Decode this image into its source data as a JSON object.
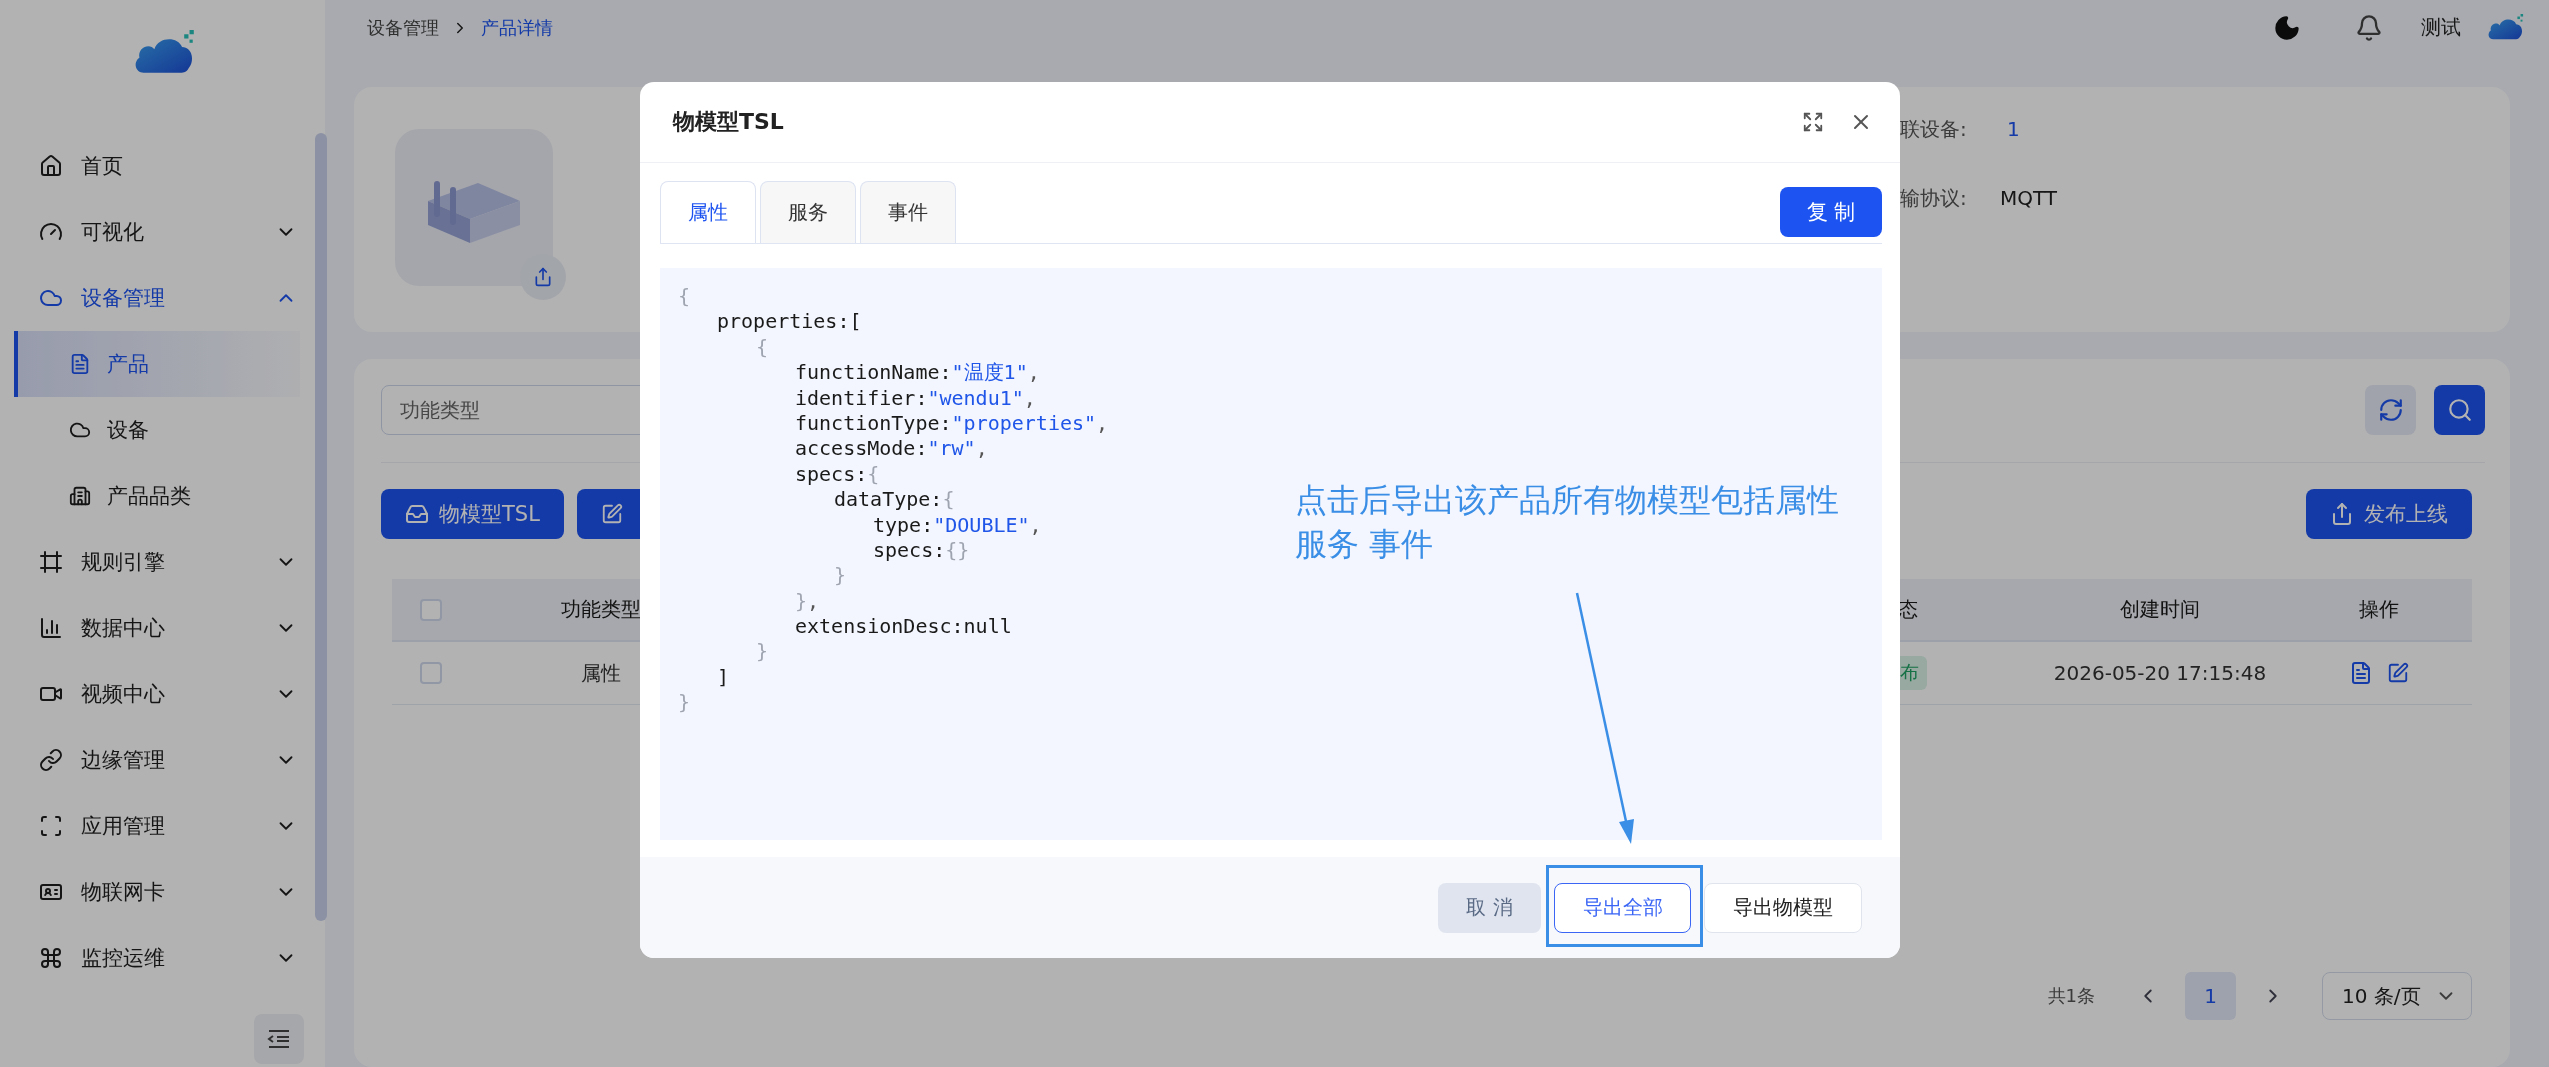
{
  "sidebar": {
    "items": [
      {
        "label": "首页",
        "kind": "link",
        "selected": false
      },
      {
        "label": "可视化",
        "kind": "group",
        "expanded": false,
        "selected": false
      },
      {
        "label": "设备管理",
        "kind": "group",
        "expanded": true,
        "selected": true,
        "children": [
          {
            "label": "产品",
            "selected": true
          },
          {
            "label": "设备",
            "selected": false
          },
          {
            "label": "产品品类",
            "selected": false
          }
        ]
      },
      {
        "label": "规则引擎",
        "kind": "group",
        "expanded": false,
        "selected": false
      },
      {
        "label": "数据中心",
        "kind": "group",
        "expanded": false,
        "selected": false
      },
      {
        "label": "视频中心",
        "kind": "group",
        "expanded": false,
        "selected": false
      },
      {
        "label": "边缘管理",
        "kind": "group",
        "expanded": false,
        "selected": false
      },
      {
        "label": "应用管理",
        "kind": "group",
        "expanded": false,
        "selected": false
      },
      {
        "label": "物联网卡",
        "kind": "group",
        "expanded": false,
        "selected": false
      },
      {
        "label": "监控运维",
        "kind": "group",
        "expanded": false,
        "selected": false
      }
    ]
  },
  "header": {
    "breadcrumb": [
      {
        "label": "设备管理",
        "current": false
      },
      {
        "label": "产品详情",
        "current": true
      }
    ],
    "user": "测试"
  },
  "product_card": {
    "fields": [
      {
        "label": "联设备:",
        "value": "1",
        "kind": "link"
      },
      {
        "label": "输协议:",
        "value": "MQTT",
        "kind": "text"
      }
    ]
  },
  "functions": {
    "filter": {
      "placeholder": "功能类型"
    },
    "buttons": [
      {
        "kind": "text",
        "label": "物模型TSL"
      },
      {
        "kind": "icon"
      }
    ],
    "publish_button": "发布上线",
    "table": {
      "all_checked": false,
      "columns": [
        "功能类型",
        "态",
        "创建时间",
        "操作"
      ],
      "rows": [
        {
          "checked": false,
          "type": "属性",
          "status": "布",
          "created": "2026-05-20 17:15:48"
        }
      ]
    },
    "pagination": {
      "total": "共1条",
      "pages": [
        {
          "label": "1",
          "selected": true
        }
      ],
      "page_size": "10 条/页"
    }
  },
  "modal": {
    "title": "物模型TSL",
    "tabs": [
      {
        "label": "属性",
        "selected": true
      },
      {
        "label": "服务",
        "selected": false
      },
      {
        "label": "事件",
        "selected": false
      }
    ],
    "copy_button": "复 制",
    "code": [
      {
        "parts": [
          {
            "kind": "brace",
            "text": "{"
          }
        ],
        "children": [
          {
            "parts": [
              {
                "kind": "key",
                "text": "properties:["
              }
            ],
            "children": [
              {
                "parts": [
                  {
                    "kind": "brace",
                    "text": "{"
                  }
                ],
                "children": [
                  {
                    "parts": [
                      {
                        "kind": "key",
                        "text": "functionName:"
                      },
                      {
                        "kind": "string",
                        "text": "\"温度1\""
                      },
                      {
                        "kind": "punct",
                        "text": ","
                      }
                    ]
                  },
                  {
                    "parts": [
                      {
                        "kind": "key",
                        "text": "identifier:"
                      },
                      {
                        "kind": "string",
                        "text": "\"wendu1\""
                      },
                      {
                        "kind": "punct",
                        "text": ","
                      }
                    ]
                  },
                  {
                    "parts": [
                      {
                        "kind": "key",
                        "text": "functionType:"
                      },
                      {
                        "kind": "string",
                        "text": "\"properties\""
                      },
                      {
                        "kind": "punct",
                        "text": ","
                      }
                    ]
                  },
                  {
                    "parts": [
                      {
                        "kind": "key",
                        "text": "accessMode:"
                      },
                      {
                        "kind": "string",
                        "text": "\"rw\""
                      },
                      {
                        "kind": "punct",
                        "text": ","
                      }
                    ]
                  },
                  {
                    "parts": [
                      {
                        "kind": "key",
                        "text": "specs:"
                      },
                      {
                        "kind": "brace",
                        "text": "{"
                      }
                    ],
                    "children": [
                      {
                        "parts": [
                          {
                            "kind": "key",
                            "text": "dataType:"
                          },
                          {
                            "kind": "brace",
                            "text": "{"
                          }
                        ],
                        "children": [
                          {
                            "parts": [
                              {
                                "kind": "key",
                                "text": "type:"
                              },
                              {
                                "kind": "string",
                                "text": "\"DOUBLE\""
                              },
                              {
                                "kind": "punct",
                                "text": ","
                              }
                            ]
                          },
                          {
                            "parts": [
                              {
                                "kind": "key",
                                "text": "specs:"
                              },
                              {
                                "kind": "brace",
                                "text": "{}"
                              }
                            ]
                          }
                        ]
                      },
                      {
                        "parts": [
                          {
                            "kind": "brace",
                            "text": "}"
                          }
                        ]
                      }
                    ]
                  },
                  {
                    "parts": [
                      {
                        "kind": "brace",
                        "text": "}"
                      },
                      {
                        "kind": "punct",
                        "text": ","
                      }
                    ]
                  },
                  {
                    "parts": [
                      {
                        "kind": "key",
                        "text": "extensionDesc:null"
                      }
                    ]
                  }
                ]
              },
              {
                "parts": [
                  {
                    "kind": "brace",
                    "text": "}"
                  }
                ]
              }
            ]
          },
          {
            "parts": [
              {
                "kind": "key",
                "text": "]"
              }
            ]
          }
        ]
      },
      {
        "parts": [
          {
            "kind": "brace",
            "text": "}"
          }
        ]
      }
    ],
    "buttons": [
      {
        "label": "取 消",
        "kind": "cancel"
      },
      {
        "label": "导出全部",
        "kind": "outline"
      },
      {
        "label": "导出物模型",
        "kind": "default"
      }
    ]
  },
  "annotation": {
    "lines": [
      "点击后导出该产品所有物模型包括属性",
      "服务 事件"
    ]
  }
}
